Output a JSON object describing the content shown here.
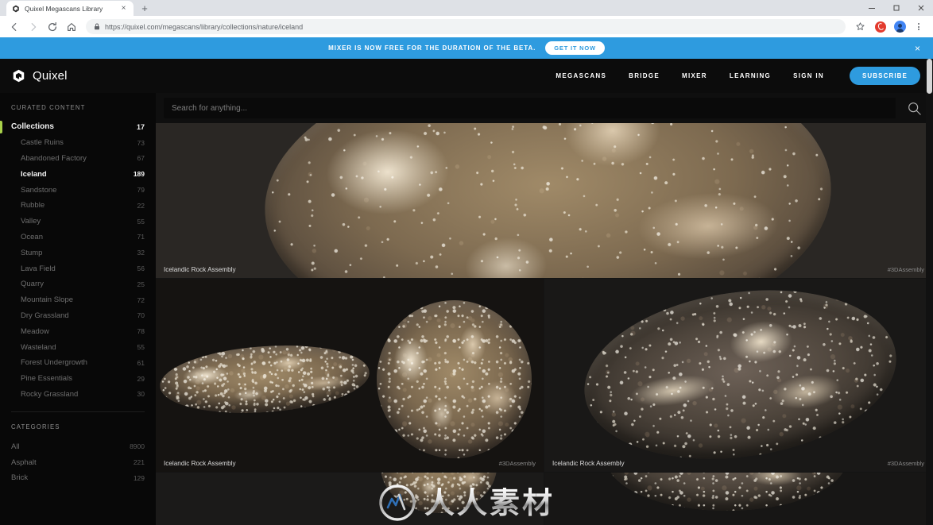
{
  "browser": {
    "tab": {
      "title": "Quixel Megascans Library",
      "favicon": "quixel-logo-icon",
      "close": "×"
    },
    "newtab_label": "+",
    "window_controls": {
      "minimize": "–",
      "maximize": "❐",
      "close": "✕"
    },
    "nav": {
      "back": "←",
      "forward": "→",
      "reload": "↻",
      "home": "⌂"
    },
    "omnibox": {
      "scheme": "https://",
      "host": "quixel.com",
      "path": "/megascans/library/collections/nature/iceland",
      "full_url": "https://quixel.com/megascans/library/collections/nature/iceland"
    },
    "toolbar_right": {
      "bookmark": "☆",
      "extension": "opera-extension-icon",
      "profile": "avatar",
      "menu": "kebab-menu"
    }
  },
  "promo": {
    "text": "MIXER IS NOW FREE FOR THE DURATION OF THE BETA.",
    "cta": "GET IT NOW",
    "close": "×",
    "bg_color": "#2e9bdf"
  },
  "site_header": {
    "brand": "Quixel",
    "nav": [
      {
        "label": "MEGASCANS"
      },
      {
        "label": "BRIDGE"
      },
      {
        "label": "MIXER"
      },
      {
        "label": "LEARNING"
      },
      {
        "label": "SIGN IN"
      }
    ],
    "cta": "SUBSCRIBE",
    "cta_color": "#2e9bdf"
  },
  "search": {
    "placeholder": "Search for anything...",
    "value": "",
    "icon": "search-icon"
  },
  "sidebar": {
    "curated_heading": "CURATED CONTENT",
    "root": {
      "label": "Collections",
      "count": "17",
      "accent_color": "#a8d14a"
    },
    "collections": [
      {
        "label": "Castle Ruins",
        "count": "73",
        "active": false
      },
      {
        "label": "Abandoned Factory",
        "count": "67",
        "active": false
      },
      {
        "label": "Iceland",
        "count": "189",
        "active": true
      },
      {
        "label": "Sandstone",
        "count": "79",
        "active": false
      },
      {
        "label": "Rubble",
        "count": "22",
        "active": false
      },
      {
        "label": "Valley",
        "count": "55",
        "active": false
      },
      {
        "label": "Ocean",
        "count": "71",
        "active": false
      },
      {
        "label": "Stump",
        "count": "32",
        "active": false
      },
      {
        "label": "Lava Field",
        "count": "56",
        "active": false
      },
      {
        "label": "Quarry",
        "count": "25",
        "active": false
      },
      {
        "label": "Mountain Slope",
        "count": "72",
        "active": false
      },
      {
        "label": "Dry Grassland",
        "count": "70",
        "active": false
      },
      {
        "label": "Meadow",
        "count": "78",
        "active": false
      },
      {
        "label": "Wasteland",
        "count": "55",
        "active": false
      },
      {
        "label": "Forest Undergrowth",
        "count": "61",
        "active": false
      },
      {
        "label": "Pine Essentials",
        "count": "29",
        "active": false
      },
      {
        "label": "Rocky Grassland",
        "count": "30",
        "active": false
      }
    ],
    "categories_heading": "CATEGORIES",
    "categories": [
      {
        "label": "All",
        "count": "8900"
      },
      {
        "label": "Asphalt",
        "count": "221"
      },
      {
        "label": "Brick",
        "count": "129"
      }
    ]
  },
  "assets": {
    "row1": [
      {
        "title": "Icelandic Rock Assembly",
        "tag": "#3DAssembly"
      }
    ],
    "row2": [
      {
        "title": "Icelandic Rock Assembly",
        "tag": "#3DAssembly"
      },
      {
        "title": "Icelandic Rock Assembly",
        "tag": "#3DAssembly"
      }
    ]
  },
  "watermark": {
    "text": "人人素材",
    "mark": "circular-logo-mark"
  }
}
